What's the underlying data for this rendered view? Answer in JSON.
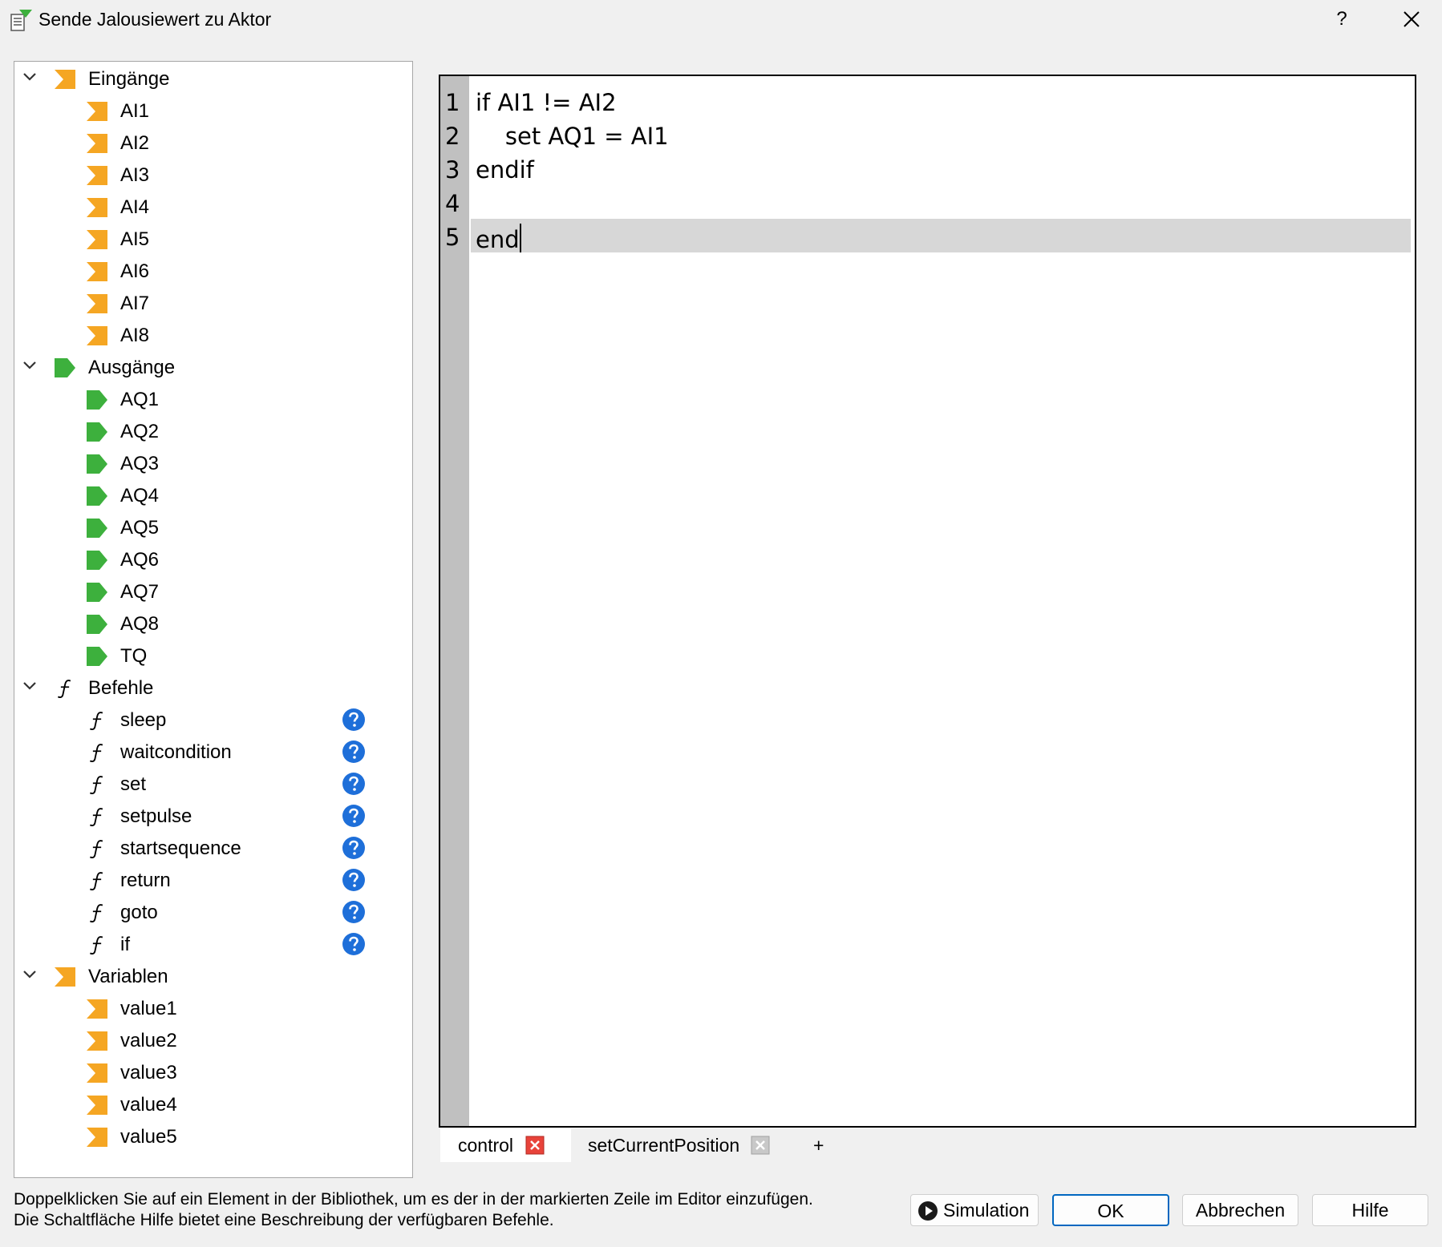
{
  "window": {
    "title": "Sende Jalousiewert zu Aktor",
    "help_label": "?"
  },
  "tree": {
    "inputs": {
      "label": "Eingänge",
      "items": [
        "AI1",
        "AI2",
        "AI3",
        "AI4",
        "AI5",
        "AI6",
        "AI7",
        "AI8"
      ]
    },
    "outputs": {
      "label": "Ausgänge",
      "items": [
        "AQ1",
        "AQ2",
        "AQ3",
        "AQ4",
        "AQ5",
        "AQ6",
        "AQ7",
        "AQ8",
        "TQ"
      ]
    },
    "commands": {
      "label": "Befehle",
      "items": [
        "sleep",
        "waitcondition",
        "set",
        "setpulse",
        "startsequence",
        "return",
        "goto",
        "if"
      ]
    },
    "variables": {
      "label": "Variablen",
      "items": [
        "value1",
        "value2",
        "value3",
        "value4",
        "value5"
      ]
    }
  },
  "editor": {
    "lines": [
      {
        "num": "1",
        "text": "if AI1 != AI2"
      },
      {
        "num": "2",
        "text": "    set AQ1 = AI1"
      },
      {
        "num": "3",
        "text": "endif"
      },
      {
        "num": "4",
        "text": ""
      },
      {
        "num": "5",
        "text": "end"
      }
    ]
  },
  "tabs": [
    {
      "label": "control"
    },
    {
      "label": "setCurrentPosition"
    },
    {
      "label": "+"
    }
  ],
  "hint": {
    "line1": "Doppelklicken Sie auf ein Element in der Bibliothek, um es der in der markierten Zeile im Editor einzufügen.",
    "line2": "Die Schaltfläche Hilfe bietet eine Beschreibung der verfügbaren Befehle."
  },
  "buttons": {
    "simulation": "Simulation",
    "ok": "OK",
    "cancel": "Abbrechen",
    "help": "Hilfe"
  },
  "colors": {
    "input_icon": "#f5a623",
    "output_icon": "#3db03d",
    "help_icon": "#1e6fd9",
    "tab_close_active": "#e8433a",
    "tab_close_inactive": "#b8b8b8",
    "default_button_border": "#0067c0"
  }
}
